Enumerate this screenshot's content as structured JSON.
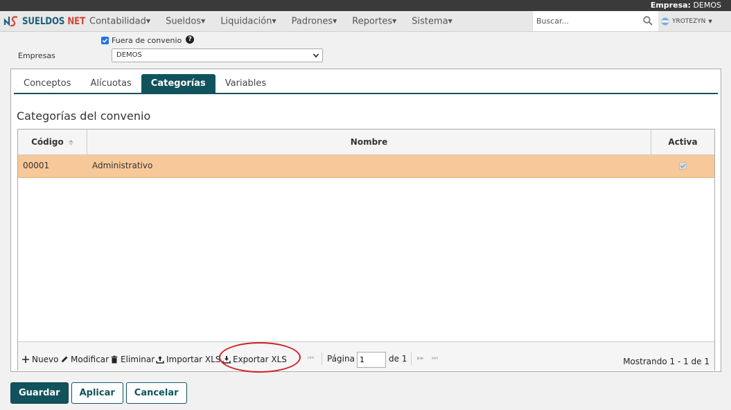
{
  "topbar": {
    "empresa_label": "Empresa:",
    "empresa_value": "DEMOS"
  },
  "brand": {
    "part1": "SUELDOS",
    "part2": "NET"
  },
  "menu": [
    {
      "label": "Contabilidad"
    },
    {
      "label": "Sueldos"
    },
    {
      "label": "Liquidación"
    },
    {
      "label": "Padrones"
    },
    {
      "label": "Reportes"
    },
    {
      "label": "Sistema"
    }
  ],
  "search": {
    "placeholder": "Buscar..."
  },
  "user": {
    "name": "YROTEZYN"
  },
  "form": {
    "fuera_label": "Fuera de convenio",
    "fuera_checked": true,
    "empresas_label": "Empresas",
    "empresas_value": "DEMOS"
  },
  "tabs": [
    {
      "label": "Conceptos",
      "active": false
    },
    {
      "label": "Alícuotas",
      "active": false
    },
    {
      "label": "Categorías",
      "active": true
    },
    {
      "label": "Variables",
      "active": false
    }
  ],
  "section": {
    "title": "Categorías del convenio"
  },
  "grid": {
    "columns": {
      "codigo": "Código",
      "nombre": "Nombre",
      "activa": "Activa"
    },
    "rows": [
      {
        "codigo": "00001",
        "nombre": "Administrativo",
        "activa": true
      }
    ]
  },
  "pager": {
    "nuevo": "Nuevo",
    "modificar": "Modificar",
    "eliminar": "Eliminar",
    "importar": "Importar XLS",
    "exportar": "Exportar XLS",
    "pagina_label": "Página",
    "pagina_value": "1",
    "de_label": "de 1",
    "showing": "Mostrando 1 - 1 de 1"
  },
  "actions": {
    "guardar": "Guardar",
    "aplicar": "Aplicar",
    "cancelar": "Cancelar"
  },
  "colors": {
    "accent": "#10535c",
    "selected_row": "#f7c898",
    "highlight": "#d02020"
  }
}
